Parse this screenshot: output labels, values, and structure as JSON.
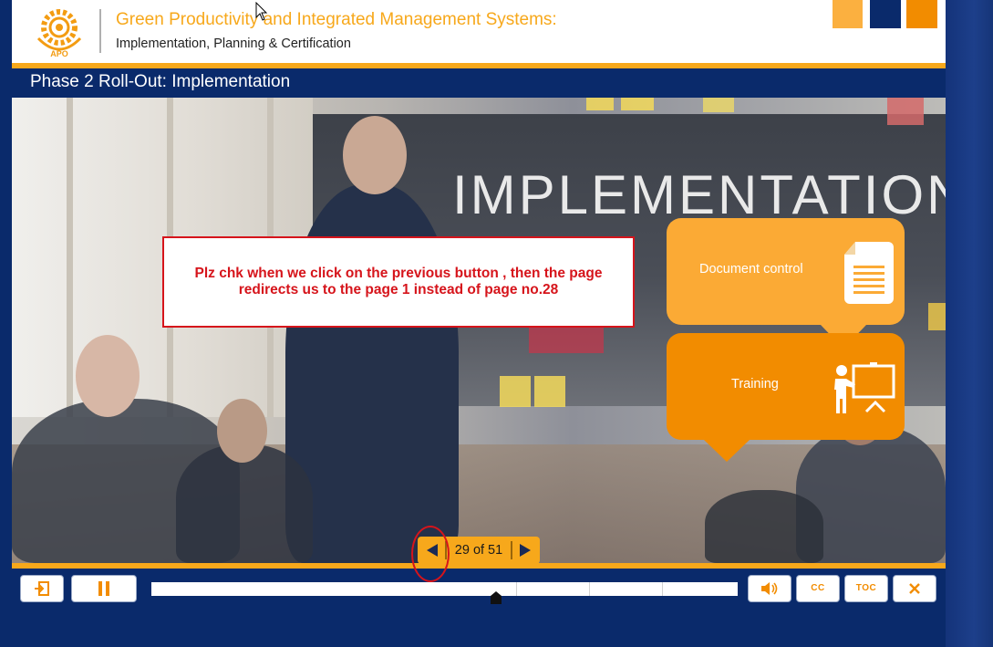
{
  "header": {
    "course_title": "Green Productivity and Integrated Management Systems:",
    "course_subtitle": "Implementation, Planning & Certification",
    "logo_text": "APO"
  },
  "slide": {
    "title": "Phase 2 Roll-Out: Implementation",
    "background_text": "IMPLEMENTATION"
  },
  "callout": {
    "text_line1": "Plz chk when we click on the previous button , then the page",
    "text_line2": "redirects us to the page 1 instead of page no.28"
  },
  "bubbles": {
    "document_control": "Document control",
    "training": "Training"
  },
  "navigation": {
    "current": 29,
    "total": 51,
    "counter_text": "29 of 51"
  },
  "controls": {
    "exit_icon": "exit-icon",
    "pause_icon": "pause-icon",
    "volume_icon": "volume-icon",
    "cc_label": "CC",
    "toc_label": "TOC",
    "close_icon": "close-icon"
  },
  "colors": {
    "brand_orange": "#f7a81b",
    "deep_orange": "#f28c00",
    "navy": "#0a2a6b",
    "annotation_red": "#d6141b"
  }
}
